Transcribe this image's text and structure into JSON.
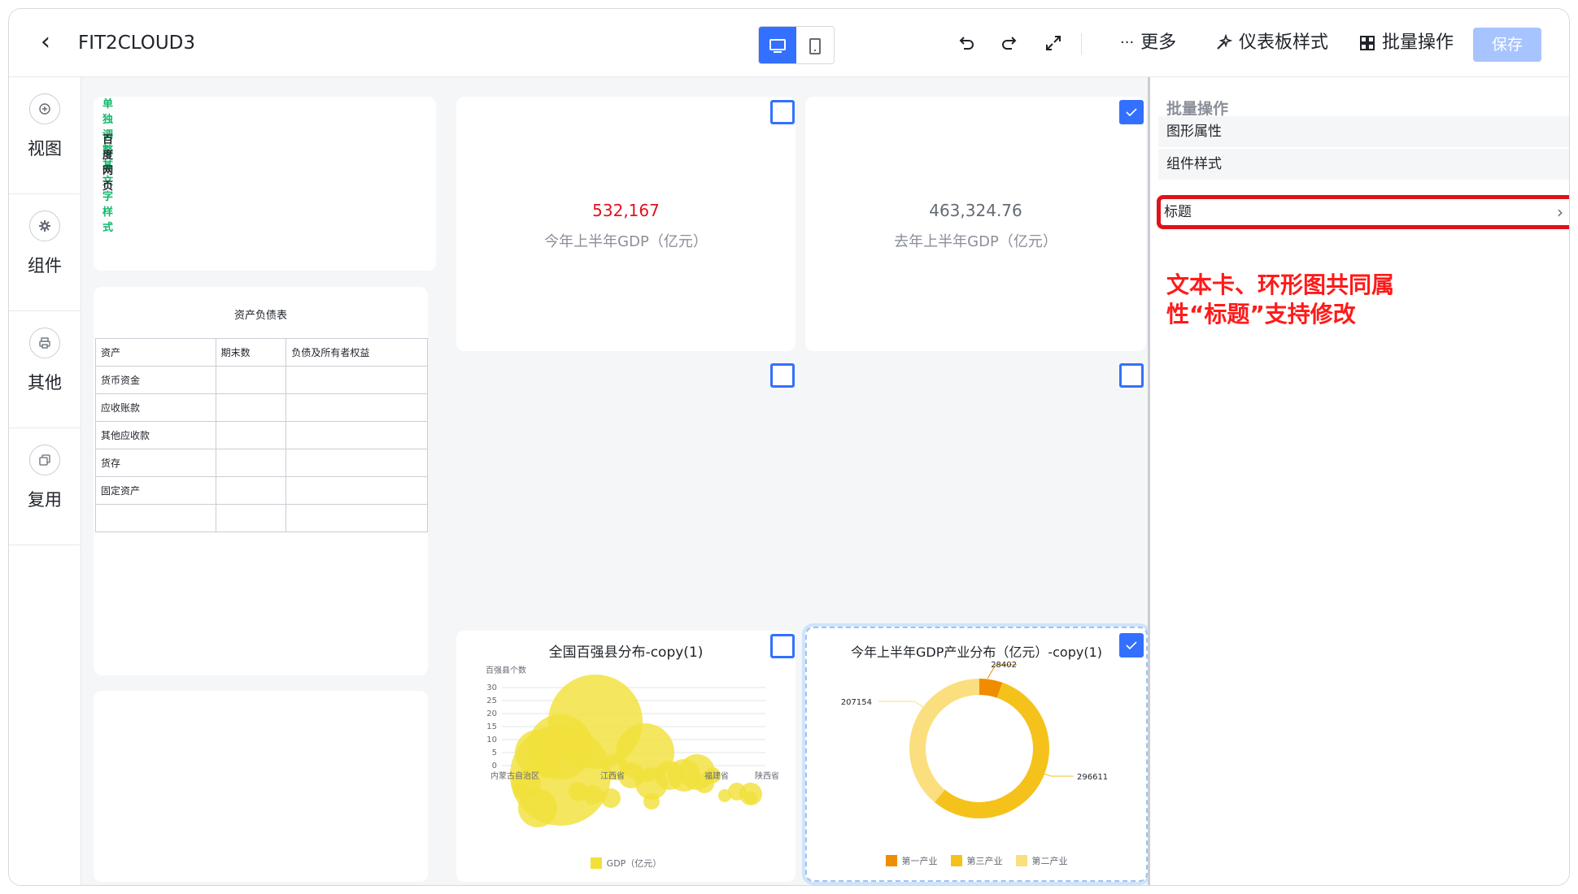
{
  "header": {
    "title": "FIT2CLOUD3",
    "more_label": "更多",
    "style_label": "仪表板样式",
    "batch_label": "批量操作",
    "save_label": "保存"
  },
  "rail": [
    {
      "label": "视图",
      "icon": "add-circle-icon"
    },
    {
      "label": "组件",
      "icon": "gear-icon"
    },
    {
      "label": "其他",
      "icon": "printer-icon"
    },
    {
      "label": "复用",
      "icon": "copy-icon"
    }
  ],
  "rich_text": {
    "title": "单独调整某文字样式",
    "link": "百度网页"
  },
  "balance_table": {
    "title": "资产负债表",
    "headers": [
      "资产",
      "期末数",
      "负债及所有者权益"
    ],
    "rows": [
      [
        "货币资金",
        "",
        ""
      ],
      [
        "应收账款",
        "",
        ""
      ],
      [
        "其他应收款",
        "",
        ""
      ],
      [
        "货存",
        "",
        ""
      ],
      [
        "固定资产",
        "",
        ""
      ],
      [
        "",
        "",
        ""
      ]
    ]
  },
  "kpi_cards": [
    {
      "value": "532,167",
      "label": "今年上半年GDP（亿元）",
      "color": "#e1111b"
    },
    {
      "value": "463,324.76",
      "label": "去年上半年GDP（亿元）",
      "color": "#646a73"
    }
  ],
  "bubble_chart": {
    "title": "全国百强县分布-copy(1)",
    "y_axis_name": "百强县个数",
    "y_ticks": [
      "30",
      "25",
      "20",
      "15",
      "10",
      "5",
      "0"
    ],
    "x_ticks": [
      "内蒙古自治区",
      "江西省",
      "福建省",
      "陕西省"
    ],
    "legend": "GDP（亿元）"
  },
  "donut_chart": {
    "title": "今年上半年GDP产业分布（亿元）-copy(1)",
    "labels": [
      "28402",
      "207154",
      "296611"
    ],
    "legend": [
      "第一产业",
      "第三产业",
      "第二产业"
    ]
  },
  "chart_data": [
    {
      "type": "scatter",
      "title": "全国百强县分布-copy(1)",
      "ylabel": "百强县个数",
      "ylim": [
        0,
        30
      ],
      "x": [
        "内蒙古自治区",
        "江西省",
        "福建省",
        "陕西省"
      ],
      "series": [
        {
          "name": "GDP（亿元）"
        }
      ]
    },
    {
      "type": "pie",
      "title": "今年上半年GDP产业分布（亿元）-copy(1)",
      "categories": [
        "第一产业",
        "第二产业",
        "第三产业"
      ],
      "values": [
        28402,
        207154,
        296611
      ],
      "colors": [
        "#f08c00",
        "#fbdf7e",
        "#f5c21b"
      ]
    }
  ],
  "panel": {
    "title": "批量操作",
    "rows": [
      "图形属性",
      "组件样式"
    ],
    "title_row": "标题",
    "annotation": "文本卡、环形图共同属性“标题”支持修改"
  }
}
